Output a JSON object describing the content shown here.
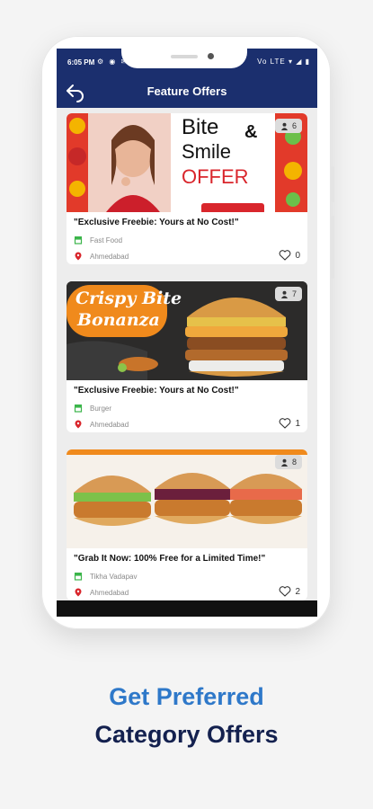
{
  "status_bar": {
    "time": "6:05 PM",
    "symbols": "⚙ ◉ ✉ ⊟",
    "right": "Vo LTE ▾ ◢ ▮"
  },
  "app_bar": {
    "title": "Feature Offers",
    "back_icon": "back-arrow-icon"
  },
  "offers": [
    {
      "banner_text": [
        "Bite",
        "&",
        "Smile",
        "OFFER"
      ],
      "count": "6",
      "title": "\"Exclusive Freebie: Yours at No Cost!\"",
      "category": "Fast Food",
      "location": "Ahmedabad",
      "likes": "0"
    },
    {
      "banner_text": [
        "Crispy Bite",
        "Bonanza"
      ],
      "count": "7",
      "title": "\"Exclusive Freebie: Yours at No Cost!\"",
      "category": "Burger",
      "location": "Ahmedabad",
      "likes": "1"
    },
    {
      "count": "8",
      "title": "\"Grab It Now: 100% Free for a Limited Time!\"",
      "category": "Tikha Vadapav",
      "location": "Ahmedabad",
      "likes": "2"
    }
  ],
  "colors": {
    "app_bar": "#1b2f6e",
    "accent_red": "#d9262c",
    "category_green": "#3bb54a",
    "cta_blue": "#2e78c9",
    "cta_navy": "#14214f"
  },
  "promo": {
    "line1": "Get Preferred",
    "line2": "Category Offers"
  }
}
